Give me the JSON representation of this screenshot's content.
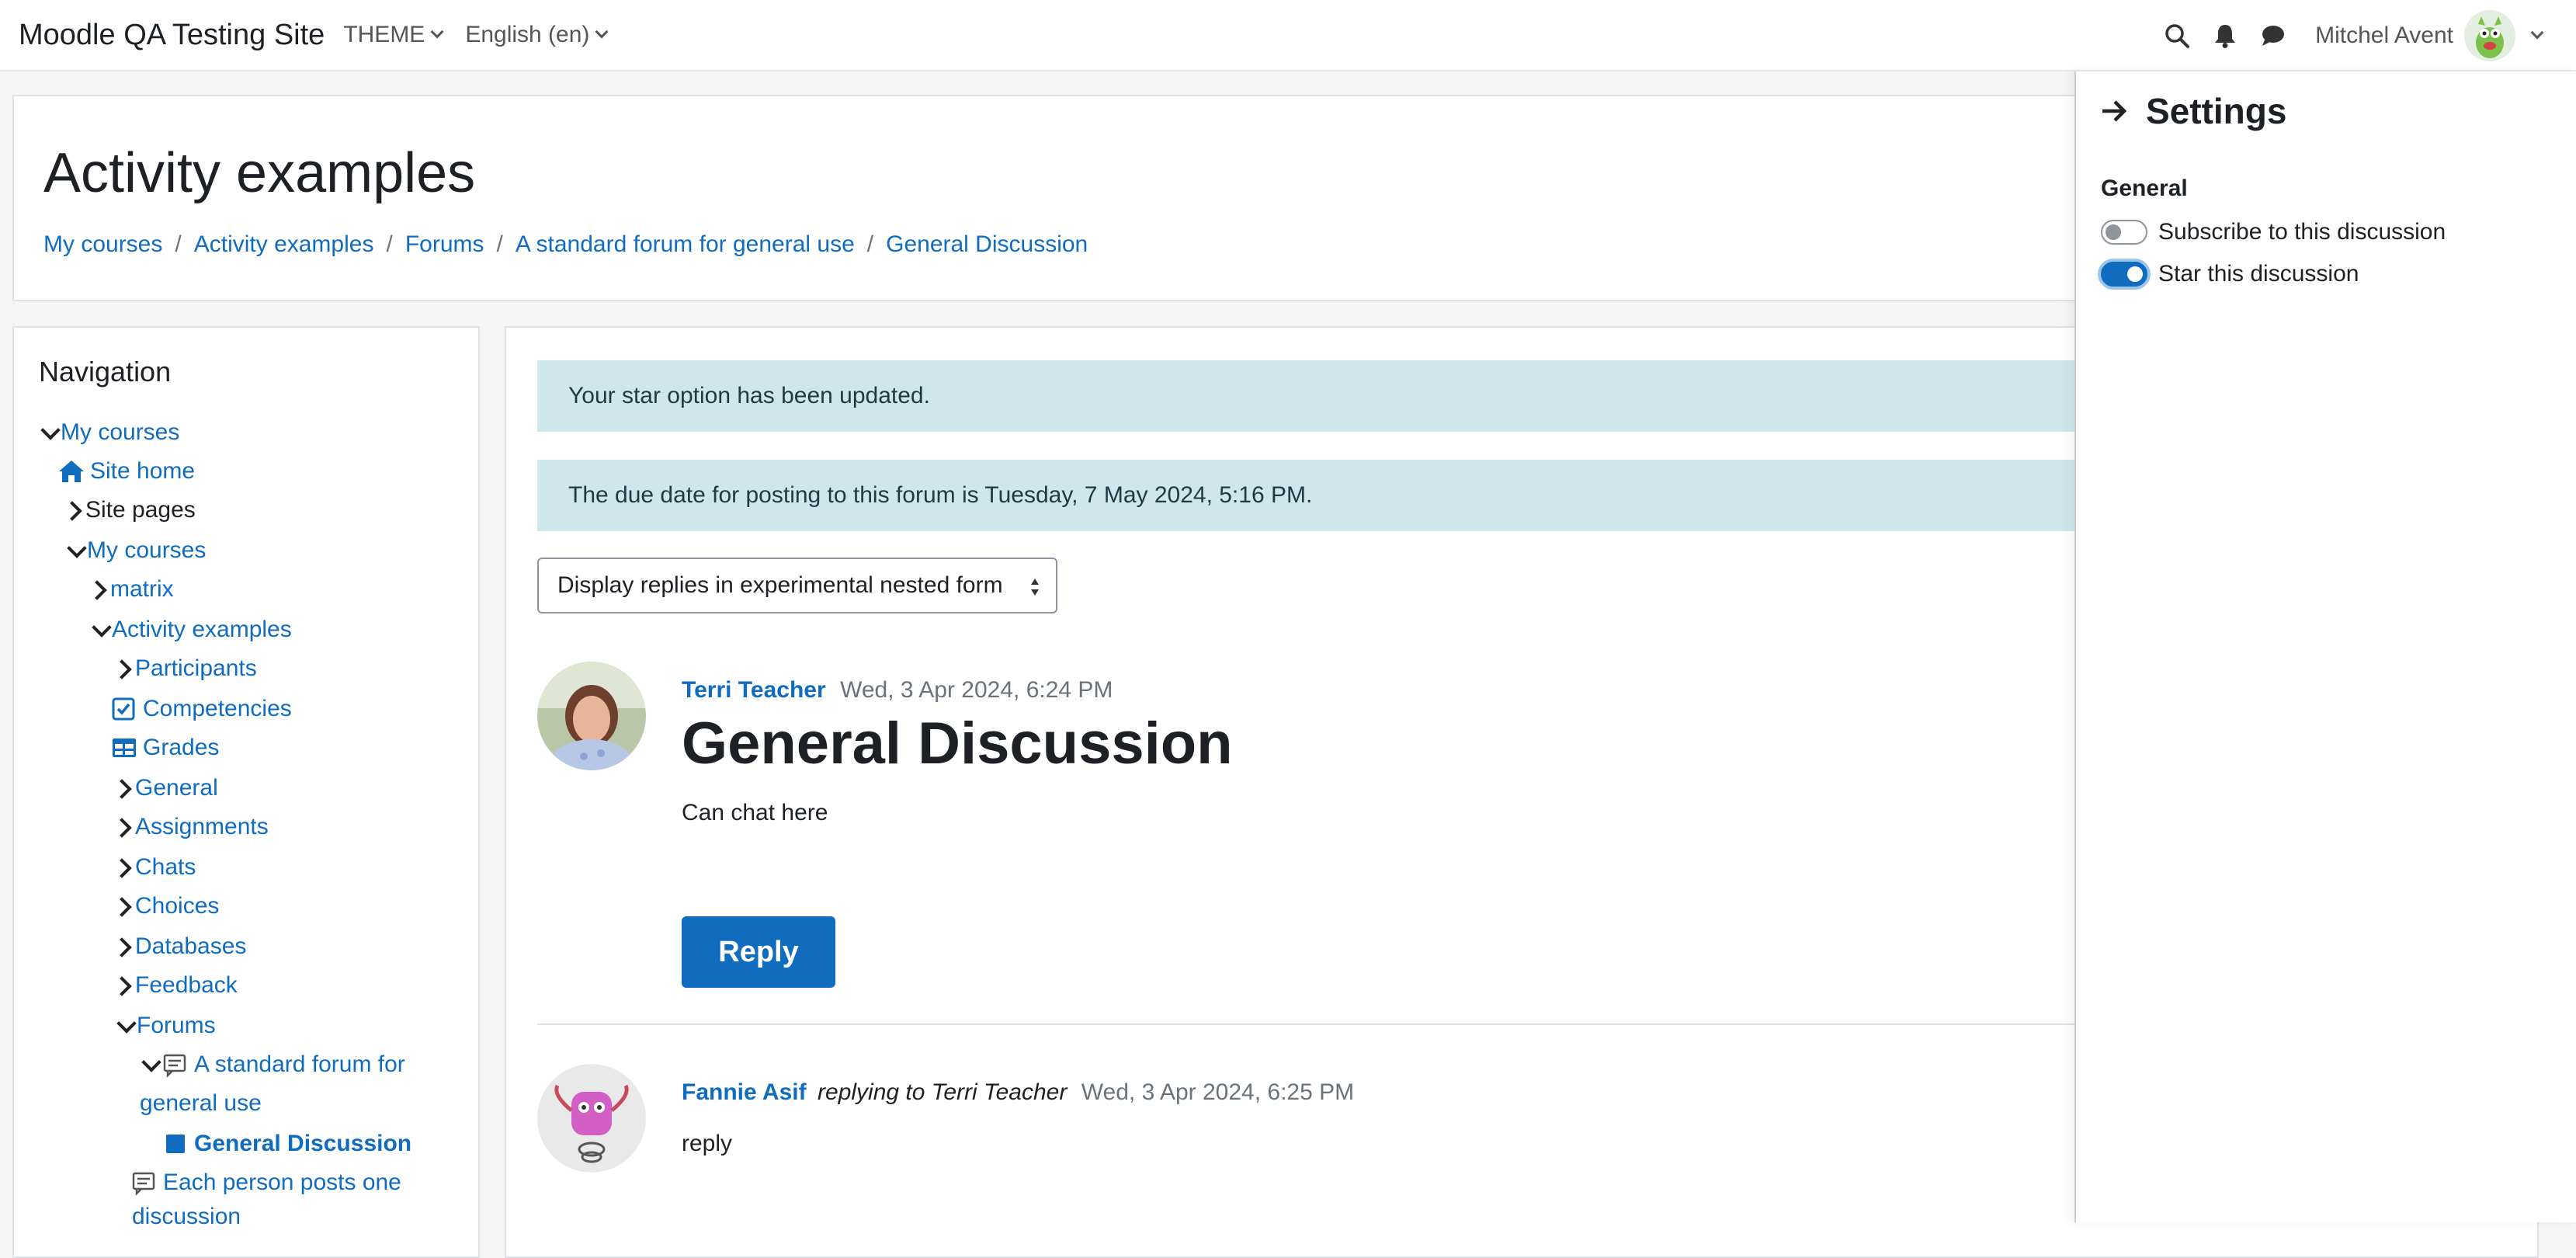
{
  "navbar": {
    "site_name": "Moodle QA Testing Site",
    "menu": [
      {
        "label": "THEME"
      },
      {
        "label": "English (en)"
      }
    ],
    "user_name": "Mitchel Avent"
  },
  "header": {
    "title": "Activity examples",
    "breadcrumb": [
      "My courses",
      "Activity examples",
      "Forums",
      "A standard forum for general use",
      "General Discussion"
    ]
  },
  "navigation": {
    "title": "Navigation",
    "items": [
      {
        "label": "My courses"
      },
      {
        "label": "Site home"
      },
      {
        "label": "Site pages"
      },
      {
        "label": "My courses"
      },
      {
        "label": "matrix"
      },
      {
        "label": "Activity examples"
      },
      {
        "label": "Participants"
      },
      {
        "label": "Competencies"
      },
      {
        "label": "Grades"
      },
      {
        "label": "General"
      },
      {
        "label": "Assignments"
      },
      {
        "label": "Chats"
      },
      {
        "label": "Choices"
      },
      {
        "label": "Databases"
      },
      {
        "label": "Feedback"
      },
      {
        "label": "Forums"
      },
      {
        "label": "A standard forum for"
      },
      {
        "label": "general use"
      },
      {
        "label": "General Discussion"
      },
      {
        "label": "Each person posts one"
      },
      {
        "label": "discussion"
      }
    ]
  },
  "alerts": [
    "Your star option has been updated.",
    "The due date for posting to this forum is Tuesday, 7 May 2024, 5:16 PM."
  ],
  "display_select": {
    "value": "Display replies in experimental nested form"
  },
  "posts": [
    {
      "author": "Terri Teacher",
      "date": "Wed, 3 Apr 2024, 6:24 PM",
      "subject": "General Discussion",
      "body": "Can chat here",
      "reply_label": "Reply"
    },
    {
      "author": "Fannie Asif",
      "replying_to": "replying to Terri Teacher",
      "date": "Wed, 3 Apr 2024, 6:25 PM",
      "body": "reply"
    }
  ],
  "drawer": {
    "title": "Settings",
    "section": "General",
    "toggles": [
      {
        "label": "Subscribe to this discussion",
        "checked": false
      },
      {
        "label": "Star this discussion",
        "checked": true
      }
    ]
  },
  "colors": {
    "brand": "#0f6cbf",
    "alert_bg": "#cfe6ea"
  }
}
